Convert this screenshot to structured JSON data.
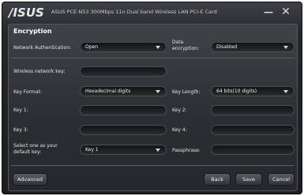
{
  "window": {
    "logo": "/ISUS",
    "title": "ASUS PCE-N53 300Mbps 11n Dual band Wireless LAN PCI-E Card",
    "minimize_glyph": "—",
    "close_glyph": "✕"
  },
  "panel": {
    "heading": "Encryption",
    "network_auth": {
      "label": "Network Authentication:",
      "value": "Open"
    },
    "data_encryption": {
      "label_line1": "Data",
      "label_line2": "encryption:",
      "value": "Disabled"
    },
    "wireless_key": {
      "label": "Wireless network key:",
      "value": ""
    },
    "key_format": {
      "label": "Key Format:",
      "value": "Hexadecimal digits"
    },
    "key_length": {
      "label": "Key Length:",
      "value": "64 bits(10 digits)"
    },
    "key1": {
      "label": "Key 1:",
      "value": ""
    },
    "key2": {
      "label": "Key 2:",
      "value": ""
    },
    "key3": {
      "label": "Key 3:",
      "value": ""
    },
    "key4": {
      "label": "Key 4:",
      "value": ""
    },
    "default_key": {
      "label_line1": "Select one as your",
      "label_line2": "default key:",
      "value": "Key 1"
    },
    "passphrase": {
      "label": "Passphrase:",
      "value": ""
    }
  },
  "buttons": {
    "advanced": "Advanced",
    "back": "Back",
    "save": "Save",
    "cancel": "Cancel"
  }
}
